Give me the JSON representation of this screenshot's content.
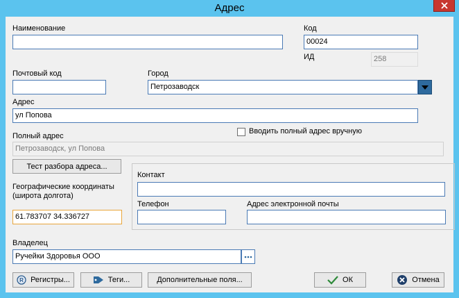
{
  "window": {
    "title": "Адрес"
  },
  "fields": {
    "name": {
      "label": "Наименование",
      "value": ""
    },
    "code": {
      "label": "Код",
      "value": "00024"
    },
    "id": {
      "label": "ИД",
      "value": "258"
    },
    "postal": {
      "label": "Почтовый код",
      "value": ""
    },
    "city": {
      "label": "Город",
      "value": "Петрозаводск"
    },
    "address": {
      "label": "Адрес",
      "value": "ул Попова"
    },
    "full_address": {
      "label": "Полный адрес",
      "value": "Петрозаводск, ул Попова"
    },
    "manual_full": {
      "label": "Вводить полный адрес вручную",
      "checked": false
    },
    "geo": {
      "label_line1": "Географические координаты",
      "label_line2": "(широта долгота)",
      "value": "61.783707 34.336727"
    },
    "contact": {
      "label": "Контакт",
      "value": ""
    },
    "phone": {
      "label": "Телефон",
      "value": ""
    },
    "email": {
      "label": "Адрес электронной почты",
      "value": ""
    },
    "owner": {
      "label": "Владелец",
      "value": "Ручейки Здоровья ООО"
    }
  },
  "buttons": {
    "parse_test": "Тест разбора адреса...",
    "registers": "Регистры...",
    "tags": "Теги...",
    "extra_fields": "Дополнительные поля...",
    "ok": "ОК",
    "cancel": "Отмена"
  },
  "colors": {
    "titlebar": "#5bc3ee",
    "close": "#c7372f",
    "input_border": "#4a7ab5",
    "focus_border": "#e8a53a"
  }
}
